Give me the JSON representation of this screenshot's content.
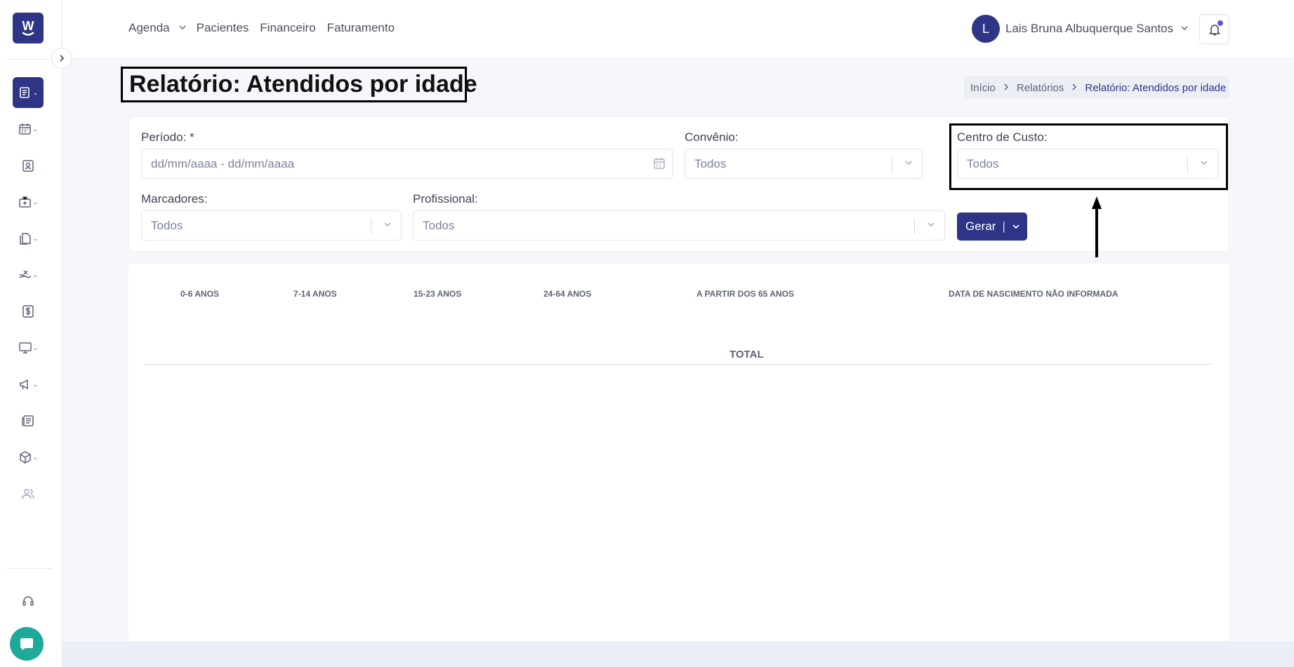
{
  "app": {
    "logo_text": "W"
  },
  "header": {
    "nav": [
      {
        "label": "Agenda",
        "has_dropdown": true
      },
      {
        "label": "Pacientes"
      },
      {
        "label": "Financeiro"
      },
      {
        "label": "Faturamento"
      }
    ],
    "user": {
      "initial": "L",
      "name": "Lais Bruna Albuquerque Santos"
    },
    "notifications": {
      "icon": "bell-icon",
      "has_unread": true
    }
  },
  "sidebar": {
    "items": [
      {
        "name": "reports",
        "icon": "report-list-icon",
        "active": true,
        "dropdown": true
      },
      {
        "name": "calendar",
        "icon": "calendar-icon",
        "dropdown": true
      },
      {
        "name": "patients",
        "icon": "patient-badge-icon",
        "dropdown": false
      },
      {
        "name": "clinic",
        "icon": "medical-briefcase-icon",
        "dropdown": true
      },
      {
        "name": "documents",
        "icon": "documents-icon",
        "dropdown": true
      },
      {
        "name": "payments",
        "icon": "hand-money-icon",
        "dropdown": true
      },
      {
        "name": "finance",
        "icon": "dollar-icon",
        "dropdown": false
      },
      {
        "name": "screen",
        "icon": "monitor-icon",
        "dropdown": true
      },
      {
        "name": "marketing",
        "icon": "megaphone-icon",
        "dropdown": true
      },
      {
        "name": "news",
        "icon": "newspaper-icon",
        "dropdown": false
      },
      {
        "name": "stock",
        "icon": "box-icon",
        "dropdown": true
      },
      {
        "name": "users",
        "icon": "users-icon",
        "dropdown": false
      }
    ],
    "support_icon": "headset-icon",
    "chat_icon": "chat-bubble-icon"
  },
  "page": {
    "title": "Relatório: Atendidos por idade",
    "breadcrumb": [
      "Início",
      "Relatórios",
      "Relatório: Atendidos por idade"
    ]
  },
  "filters": {
    "periodo": {
      "label": "Período: *",
      "placeholder": "dd/mm/aaaa - dd/mm/aaaa"
    },
    "convenio": {
      "label": "Convênio:",
      "value": "Todos"
    },
    "centro_custo": {
      "label": "Centro de Custo:",
      "value": "Todos"
    },
    "marcadores": {
      "label": "Marcadores:",
      "value": "Todos"
    },
    "profissional": {
      "label": "Profissional:",
      "value": "Todos"
    },
    "generate_label": "Gerar"
  },
  "table": {
    "columns": [
      "0-6 ANOS",
      "7-14 ANOS",
      "15-23 ANOS",
      "24-64 ANOS",
      "A PARTIR DOS 65 ANOS",
      "DATA DE NASCIMENTO NÃO INFORMADA"
    ],
    "total_label": "TOTAL"
  },
  "colors": {
    "primary": "#2e3587",
    "chat": "#1fa99a",
    "background": "#f6f7fb"
  }
}
